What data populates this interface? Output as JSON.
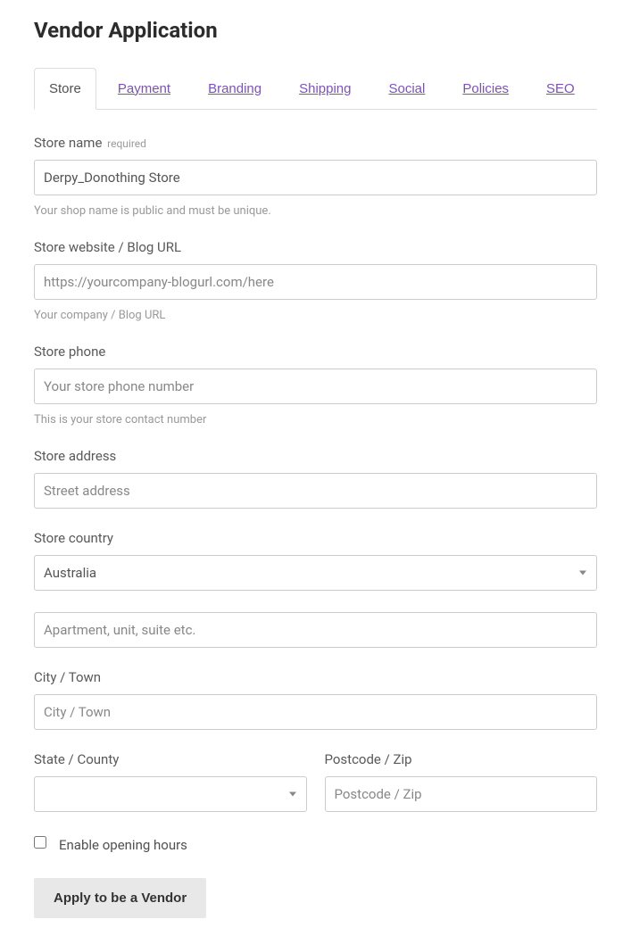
{
  "page_title": "Vendor Application",
  "tabs": [
    {
      "label": "Store",
      "active": true
    },
    {
      "label": "Payment",
      "active": false
    },
    {
      "label": "Branding",
      "active": false
    },
    {
      "label": "Shipping",
      "active": false
    },
    {
      "label": "Social",
      "active": false
    },
    {
      "label": "Policies",
      "active": false
    },
    {
      "label": "SEO",
      "active": false
    }
  ],
  "fields": {
    "store_name": {
      "label": "Store name",
      "required_tag": "required",
      "value": "Derpy_Donothing Store",
      "help": "Your shop name is public and must be unique."
    },
    "store_website": {
      "label": "Store website / Blog URL",
      "placeholder": "https://yourcompany-blogurl.com/here",
      "help": "Your company / Blog URL"
    },
    "store_phone": {
      "label": "Store phone",
      "placeholder": "Your store phone number",
      "help": "This is your store contact number"
    },
    "store_address": {
      "label": "Store address",
      "placeholder": "Street address"
    },
    "store_country": {
      "label": "Store country",
      "selected": "Australia"
    },
    "address2": {
      "placeholder": "Apartment, unit, suite etc."
    },
    "city": {
      "label": "City / Town",
      "placeholder": "City / Town"
    },
    "state": {
      "label": "State / County"
    },
    "postcode": {
      "label": "Postcode / Zip",
      "placeholder": "Postcode / Zip"
    },
    "opening_hours": {
      "label": "Enable opening hours"
    }
  },
  "submit_label": "Apply to be a Vendor"
}
